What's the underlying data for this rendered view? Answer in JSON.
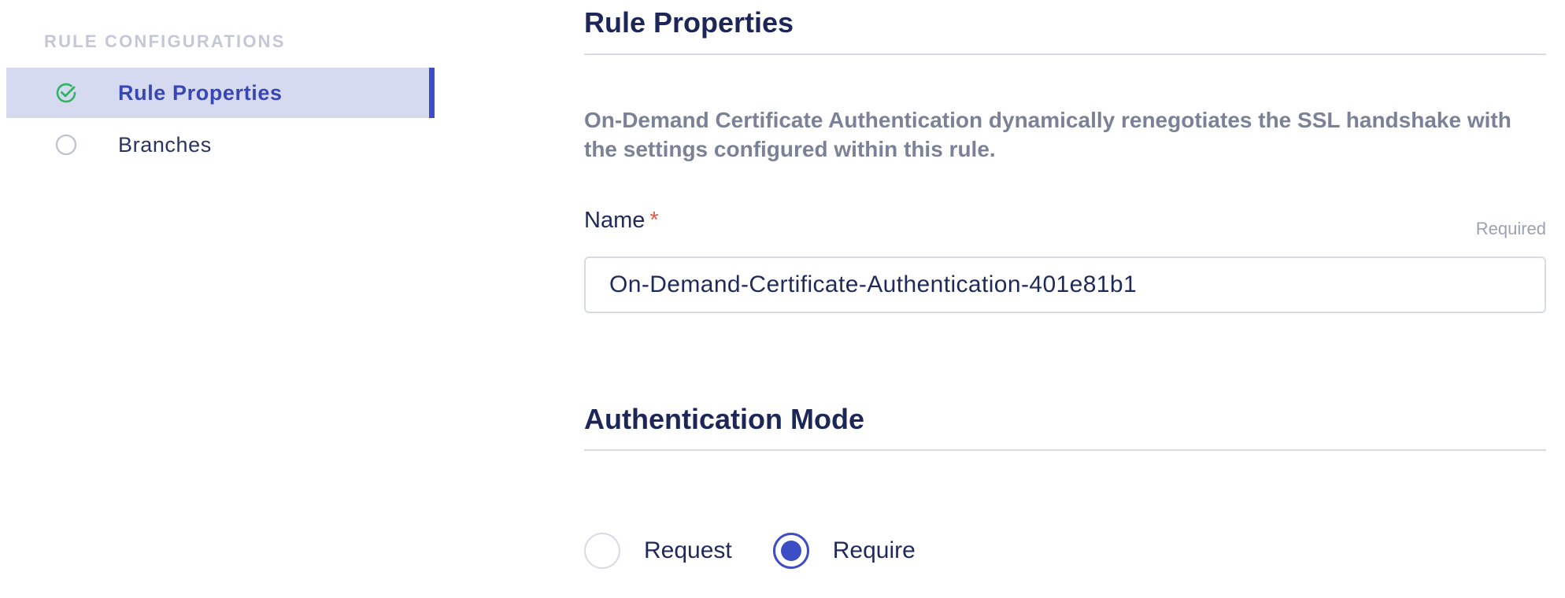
{
  "sidebar": {
    "heading": "RULE CONFIGURATIONS",
    "items": [
      {
        "label": "Rule Properties",
        "status": "complete",
        "icon": "check-circle-icon",
        "active": true
      },
      {
        "label": "Branches",
        "status": "incomplete",
        "icon": "empty-circle-icon",
        "active": false
      }
    ]
  },
  "rule_properties": {
    "title": "Rule Properties",
    "description": "On-Demand Certificate Authentication dynamically renegotiates the SSL handshake with the settings configured within this rule.",
    "name_field": {
      "label": "Name",
      "required_marker": "*",
      "required_hint": "Required",
      "value": "On-Demand-Certificate-Authentication-401e81b1"
    }
  },
  "authentication_mode": {
    "title": "Authentication Mode",
    "options": [
      {
        "label": "Request",
        "selected": false
      },
      {
        "label": "Require",
        "selected": true
      }
    ]
  },
  "colors": {
    "accent": "#3d4dc5",
    "active_item_bg": "#d5daf0",
    "success": "#2fb463",
    "required": "#e8593b"
  }
}
